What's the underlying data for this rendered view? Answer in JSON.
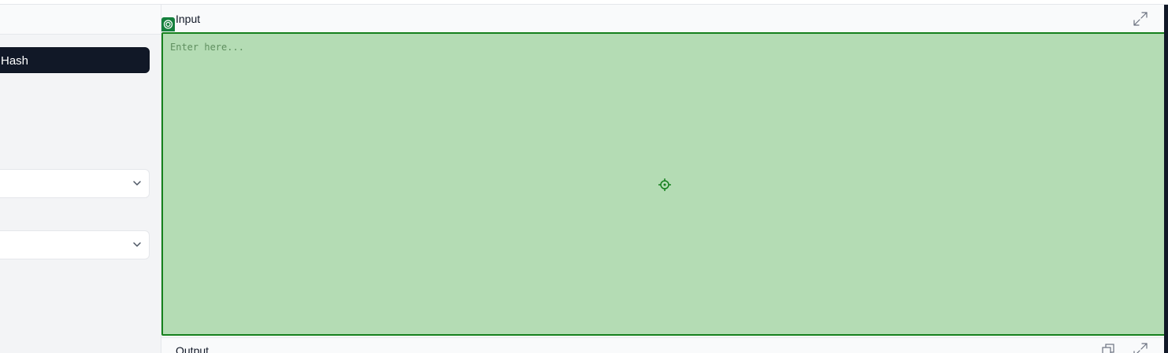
{
  "sidebar": {
    "hash_button_label": "Hash",
    "select_1": {
      "value": "",
      "icon": "chevron-down-icon"
    },
    "select_2": {
      "value": "",
      "icon": "chevron-down-icon"
    }
  },
  "input_panel": {
    "title": "Input",
    "placeholder": "Enter here...",
    "value": "",
    "expand_icon": "expand-icon",
    "badge_icon": "target-icon",
    "center_icon": "crosshair-icon"
  },
  "output_panel": {
    "title": "Output",
    "copy_icon": "copy-icon",
    "expand_icon": "expand-icon"
  },
  "colors": {
    "input_highlight": "#b4dcb4",
    "input_border": "#15801d",
    "button_dark": "#111827",
    "sidebar_bg": "#f3f4f6"
  }
}
